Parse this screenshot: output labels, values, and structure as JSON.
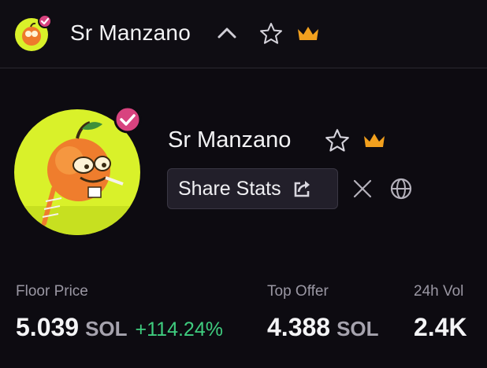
{
  "header": {
    "collection_name": "Sr Manzano",
    "icons": [
      "verified-badge-icon",
      "chevron-up-icon",
      "star-icon",
      "crown-icon"
    ]
  },
  "profile": {
    "name": "Sr Manzano",
    "share_label": "Share Stats",
    "icons": [
      "verified-badge-icon",
      "star-icon",
      "crown-icon",
      "share-icon",
      "x-icon",
      "globe-icon"
    ]
  },
  "stats": {
    "floor": {
      "label": "Floor Price",
      "value": "5.039",
      "unit": "SOL",
      "change": "+114.24%"
    },
    "top_offer": {
      "label": "Top Offer",
      "value": "4.388",
      "unit": "SOL"
    },
    "volume": {
      "label": "24h Vol",
      "value": "2.4K"
    }
  },
  "colors": {
    "background": "#0d0b11",
    "crown": "#f2a01e",
    "verified_badge": "#d8437f",
    "positive_change": "#3fcc7f",
    "avatar_bg": "#d9f12a"
  }
}
